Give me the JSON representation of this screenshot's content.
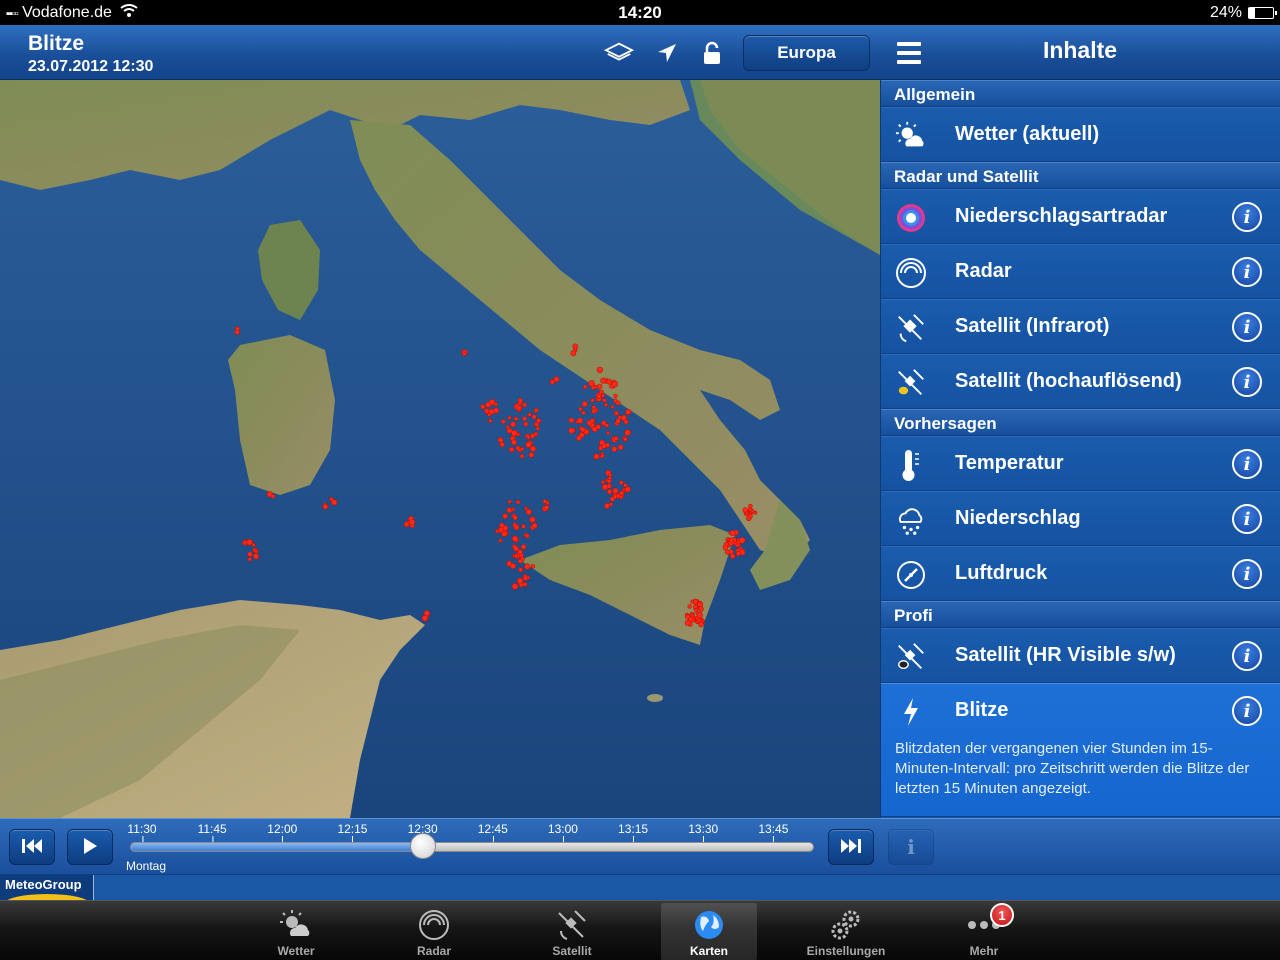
{
  "status_bar": {
    "carrier": "Vodafone.de",
    "time": "14:20",
    "battery": "24%",
    "battery_level": 0.24
  },
  "header": {
    "title": "Blitze",
    "datetime": "23.07.2012 12:30",
    "region_button": "Europa",
    "panel_title": "Inhalte",
    "icons": [
      "layers-icon",
      "location-arrow-icon",
      "lock-icon",
      "menu-icon"
    ]
  },
  "panel": {
    "sections": [
      {
        "title": "Allgemein",
        "items": [
          {
            "label": "Wetter (aktuell)",
            "icon": "sun-cloud-icon",
            "info": false
          }
        ]
      },
      {
        "title": "Radar und Satellit",
        "items": [
          {
            "label": "Niederschlagsartradar",
            "icon": "precip-radar-icon",
            "info": true
          },
          {
            "label": "Radar",
            "icon": "radar-icon",
            "info": true
          },
          {
            "label": "Satellit (Infrarot)",
            "icon": "satellite-icon",
            "info": true
          },
          {
            "label": "Satellit (hochauflösend)",
            "icon": "satellite-hd-icon",
            "info": true
          }
        ]
      },
      {
        "title": "Vorhersagen",
        "items": [
          {
            "label": "Temperatur",
            "icon": "thermometer-icon",
            "info": true
          },
          {
            "label": "Niederschlag",
            "icon": "rain-cloud-icon",
            "info": true
          },
          {
            "label": "Luftdruck",
            "icon": "barometer-icon",
            "info": true
          }
        ]
      },
      {
        "title": "Profi",
        "items": [
          {
            "label": "Satellit (HR Visible s/w)",
            "icon": "satellite-bw-icon",
            "info": true
          },
          {
            "label": "Blitze",
            "icon": "lightning-icon",
            "info": true,
            "selected": true,
            "description": "Blitzdaten der vergangenen vier Stunden im 15-Minuten-Intervall: pro Zeitschritt werden die Blitze der letzten 15 Minuten angezeigt."
          }
        ]
      }
    ]
  },
  "timeline": {
    "ticks": [
      "11:30",
      "11:45",
      "12:00",
      "12:15",
      "12:30",
      "12:45",
      "13:00",
      "13:15",
      "13:30",
      "13:45"
    ],
    "selected_index": 4,
    "day": "Montag",
    "info_label": "i"
  },
  "logo": {
    "text": "MeteoGroup"
  },
  "tabs": [
    {
      "label": "Wetter",
      "icon": "sun-cloud-icon"
    },
    {
      "label": "Radar",
      "icon": "radar-icon"
    },
    {
      "label": "Satellit",
      "icon": "satellite-icon"
    },
    {
      "label": "Karten",
      "icon": "globe-icon",
      "active": true
    },
    {
      "label": "Einstellungen",
      "icon": "gears-icon"
    },
    {
      "label": "Mehr",
      "icon": "more-dots-icon",
      "badge": "1"
    }
  ],
  "colors": {
    "accent": "#1456a8",
    "selected": "#1a6bd4",
    "lightning": "#ff2a1a"
  }
}
